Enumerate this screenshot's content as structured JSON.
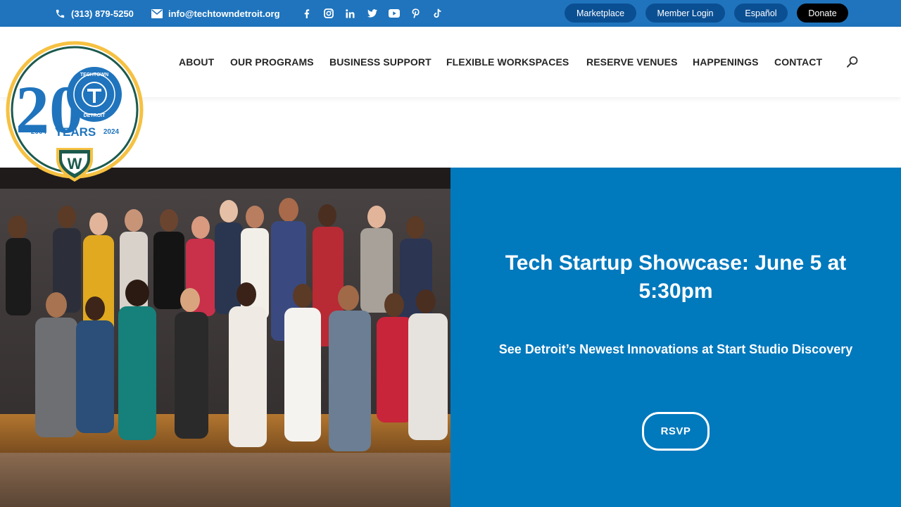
{
  "topbar": {
    "phone": "(313) 879-5250",
    "email": "info@techtowndetroit.org",
    "socials": [
      "facebook-icon",
      "instagram-icon",
      "linkedin-icon",
      "twitter-icon",
      "youtube-icon",
      "pinterest-icon",
      "tiktok-icon"
    ],
    "buttons": {
      "marketplace": "Marketplace",
      "member_login": "Member Login",
      "espanol": "Español",
      "donate": "Donate"
    },
    "colors": {
      "bar": "#1f74bd",
      "pill": "#0b4f93",
      "donate": "#000000"
    }
  },
  "logo": {
    "number": "20",
    "wordmark_top": "TECHTOWN",
    "wordmark_bottom": "DETROIT",
    "years": "YEARS",
    "start_year": "2004",
    "end_year": "2024",
    "badge_letter": "W"
  },
  "nav": {
    "items": [
      "ABOUT",
      "OUR PROGRAMS",
      "BUSINESS SUPPORT",
      "FLEXIBLE WORKSPACES",
      "RESERVE VENUES",
      "HAPPENINGS",
      "CONTACT"
    ]
  },
  "hero": {
    "title": "Tech Startup Showcase: June 5 at 5:30pm",
    "subtitle": "See Detroit’s Newest Innovations at Start Studio Discovery",
    "cta": "RSVP",
    "panel_color": "#0079bd"
  }
}
